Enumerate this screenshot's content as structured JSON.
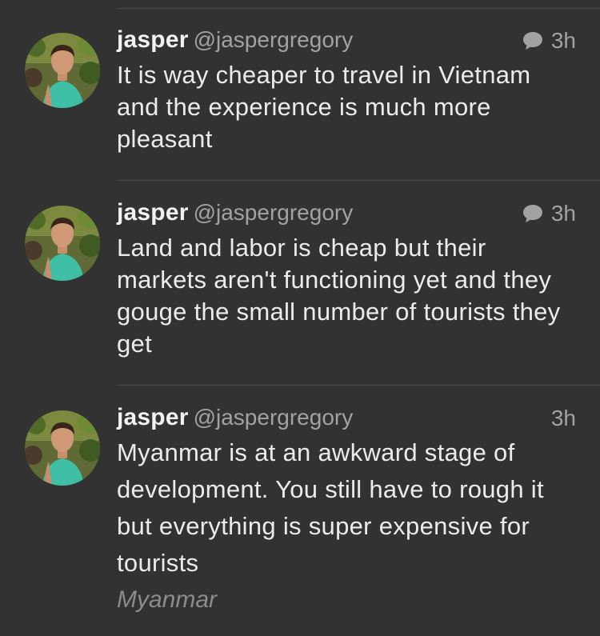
{
  "tweets": [
    {
      "name": "jasper",
      "handle": "@jaspergregory",
      "time": "3h",
      "has_reply_icon": true,
      "text": "It is way cheaper to travel in Vietnam and the experience is much more pleasant"
    },
    {
      "name": "jasper",
      "handle": "@jaspergregory",
      "time": "3h",
      "has_reply_icon": true,
      "text": "Land and labor is cheap but their markets aren't functioning yet and they gouge the small number of tourists they get"
    },
    {
      "name": "jasper",
      "handle": "@jaspergregory",
      "time": "3h",
      "has_reply_icon": false,
      "text": "Myanmar is at an awkward stage of development. You still have to rough it but everything is super expensive for tourists",
      "location": "Myanmar"
    }
  ],
  "icons": {
    "reply": "speech-bubble-icon",
    "avatar": "profile-photo"
  },
  "colors": {
    "background": "#323232",
    "text": "#ebebeb",
    "secondary": "#a2a2a2",
    "location": "#8c8c8c",
    "divider": "#4a4a4a"
  }
}
